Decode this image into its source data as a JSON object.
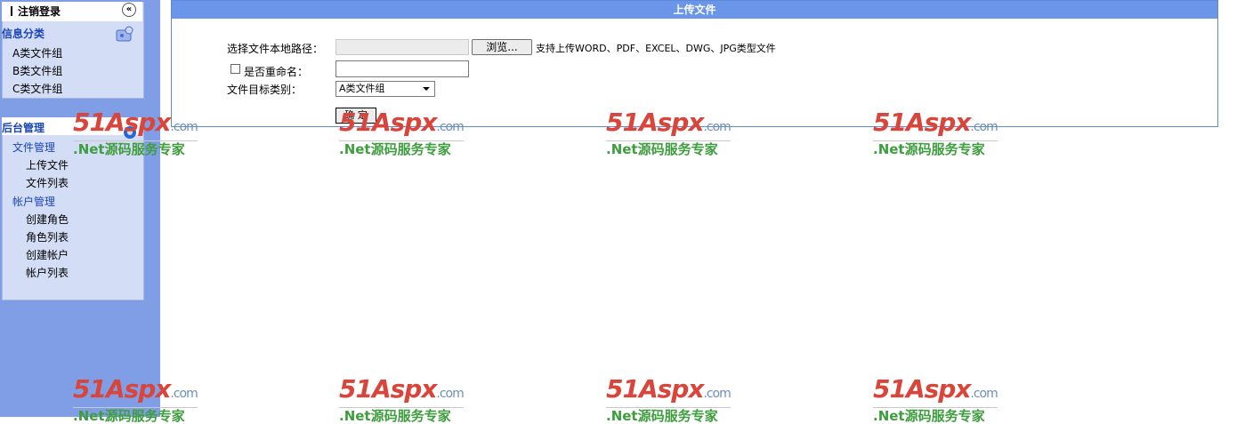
{
  "sidebar": {
    "logout_label": "注销登录",
    "collapse_symbol": "«",
    "info_section": {
      "title": "信息分类",
      "items": [
        "A类文件组",
        "B类文件组",
        "C类文件组"
      ]
    },
    "admin_section": {
      "title": "后台管理",
      "groups": [
        {
          "title": "文件管理",
          "items": [
            "上传文件",
            "文件列表"
          ]
        },
        {
          "title": "帐户管理",
          "items": [
            "创建角色",
            "角色列表",
            "创建帐户",
            "帐户列表"
          ]
        }
      ]
    }
  },
  "upload": {
    "header": "上传文件",
    "path_label": "选择文件本地路径：",
    "browse_label": "浏览...",
    "support_text": "支持上传WORD、PDF、EXCEL、DWG、JPG类型文件",
    "rename_label": "是否重命名：",
    "rename_value": "",
    "category_label": "文件目标类别：",
    "category_selected": "A类文件组",
    "submit_label": "确 定"
  },
  "watermark": {
    "logo": "51Aspx",
    "domain": ".com",
    "tagline": ".Net源码服务专家"
  },
  "colors": {
    "sidebar_bg": "#7f9ee6",
    "panel_bg": "#d4ddf6",
    "header_bg": "#6a95e8",
    "link_blue": "#1a46b8"
  }
}
